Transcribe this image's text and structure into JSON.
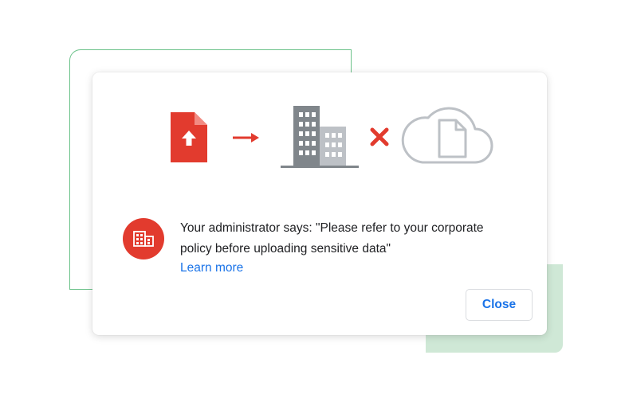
{
  "dialog": {
    "message": "Your administrator says: \"Please refer to your corporate policy before uploading sensitive data\"",
    "learn_more_label": "Learn more",
    "close_label": "Close"
  },
  "illustration": {
    "icons": [
      "file-upload-icon",
      "arrow-right-icon",
      "building-icon",
      "blocked-x-icon",
      "cloud-document-icon"
    ]
  },
  "badge": {
    "icon": "building-icon"
  },
  "colors": {
    "accent_red": "#e23b2e",
    "link_blue": "#1a73e8",
    "text": "#202124",
    "building_dark": "#80868b",
    "building_light": "#bdc1c6",
    "deco_green_line": "#6cc28a",
    "deco_green_fill": "#cfe8d6"
  }
}
